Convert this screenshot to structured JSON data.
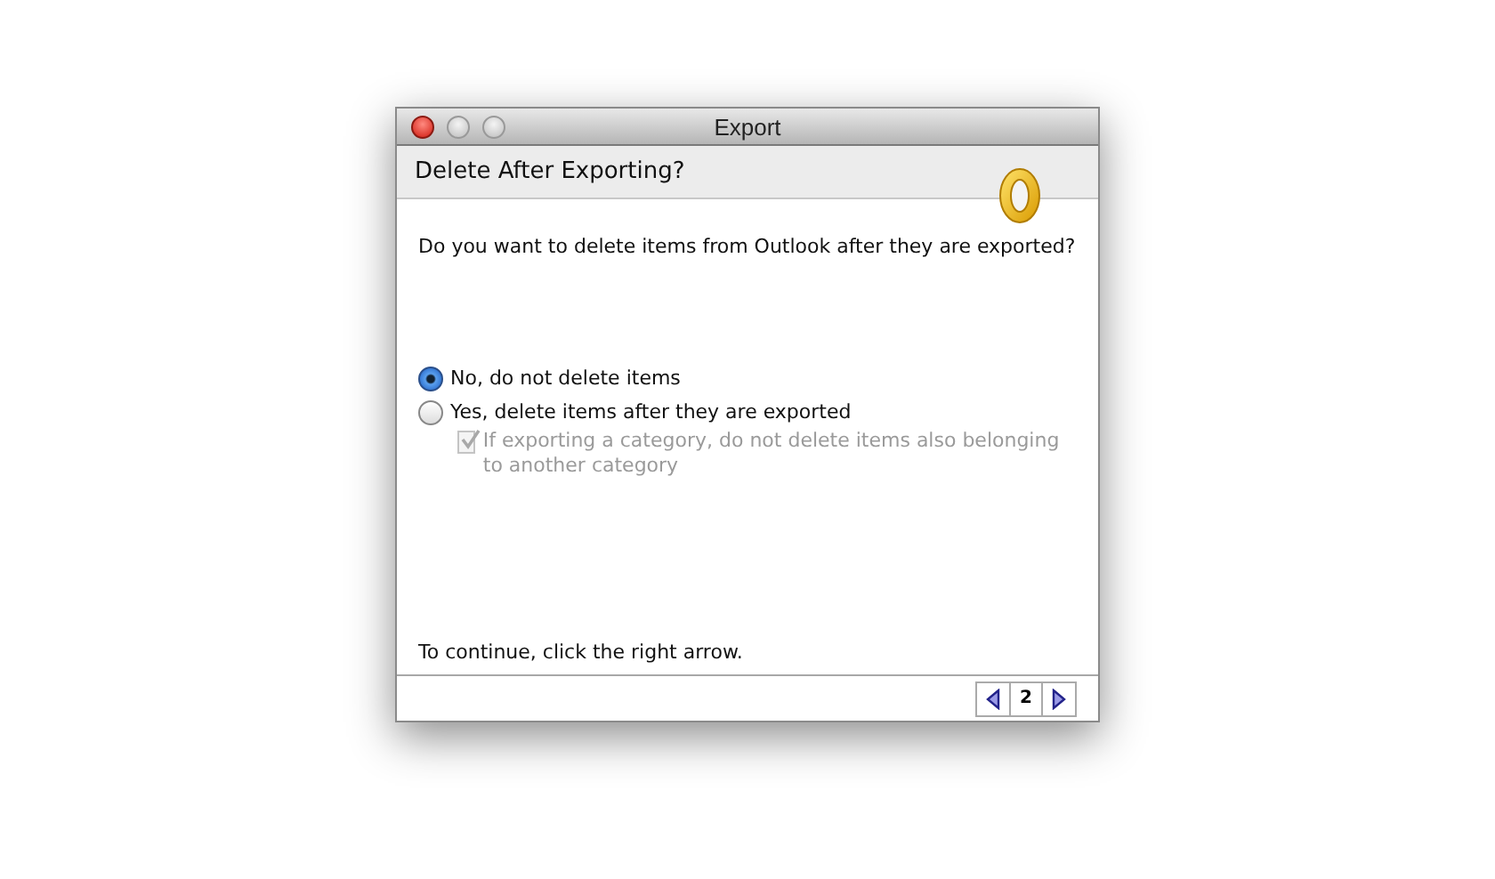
{
  "window": {
    "title": "Export"
  },
  "header": {
    "title": "Delete After Exporting?"
  },
  "question": "Do you want to delete items from Outlook after they are exported?",
  "options": [
    {
      "kind": "radio",
      "label": "No, do not delete items",
      "selected": true,
      "disabled": false
    },
    {
      "kind": "radio",
      "label": "Yes, delete items after they are exported",
      "selected": false,
      "disabled": false
    },
    {
      "kind": "checkbox",
      "label": "If exporting a category, do not delete items also belonging to another category",
      "checked": true,
      "disabled": true
    }
  ],
  "hint": "To continue, click the right arrow.",
  "pager": {
    "page": "2"
  }
}
